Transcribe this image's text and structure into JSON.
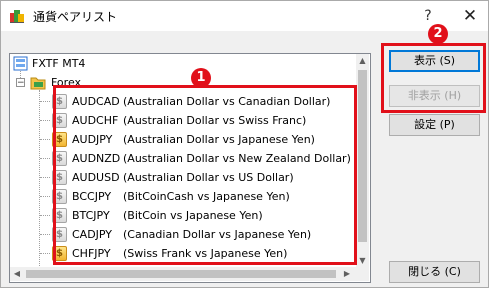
{
  "window": {
    "title": "通貨ペアリスト",
    "help_label": "?",
    "close_label": "✕"
  },
  "tree": {
    "root_label": "FXTF MT4",
    "group_label": "Forex",
    "group_expander": "−",
    "items": [
      {
        "symbol": "AUDCAD",
        "description": "(Australian Dollar vs Canadian Dollar)",
        "active": false
      },
      {
        "symbol": "AUDCHF",
        "description": "(Australian Dollar vs Swiss Franc)",
        "active": false
      },
      {
        "symbol": "AUDJPY",
        "description": "(Australian Dollar vs Japanese Yen)",
        "active": true
      },
      {
        "symbol": "AUDNZD",
        "description": "(Australian Dollar vs New Zealand Dollar)",
        "active": false
      },
      {
        "symbol": "AUDUSD",
        "description": "(Australian Dollar vs US Dollar)",
        "active": false
      },
      {
        "symbol": "BCCJPY",
        "description": "(BitCoinCash vs Japanese Yen)",
        "active": false
      },
      {
        "symbol": "BTCJPY",
        "description": "(BitCoin vs Japanese Yen)",
        "active": false
      },
      {
        "symbol": "CADJPY",
        "description": "(Canadian Dollar vs Japanese Yen)",
        "active": false
      },
      {
        "symbol": "CHFJPY",
        "description": "(Swiss Frank vs Japanese Yen)",
        "active": true
      }
    ],
    "symbol_glyph": "$"
  },
  "scrollbar": {
    "up": "▲",
    "down": "▼",
    "left": "◀",
    "right": "▶"
  },
  "buttons": {
    "show": "表示 (S)",
    "hide": "非表示 (H)",
    "settings": "設定 (P)",
    "close": "閉じる (C)"
  },
  "annotations": {
    "badge_1": "1",
    "badge_2": "2",
    "highlight_color": "#e1101a"
  },
  "colors": {
    "active_symbol_icon": "#f2b531",
    "inactive_symbol_icon": "#d9d9d9"
  }
}
